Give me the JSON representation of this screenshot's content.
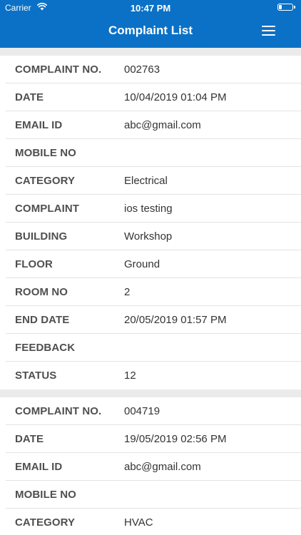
{
  "status_bar": {
    "carrier": "Carrier",
    "time": "10:47 PM",
    "battery_level": 0.2,
    "wifi_icon": "wifi-icon",
    "battery_icon": "battery-icon"
  },
  "header": {
    "title": "Complaint List",
    "menu_icon": "hamburger-menu-icon",
    "background_color": "#0b71c6"
  },
  "complaints": [
    {
      "rows": [
        {
          "label": "COMPLAINT NO.",
          "value": "002763"
        },
        {
          "label": "DATE",
          "value": "10/04/2019 01:04 PM"
        },
        {
          "label": "EMAIL ID",
          "value": "abc@gmail.com"
        },
        {
          "label": "MOBILE NO",
          "value": ""
        },
        {
          "label": "CATEGORY",
          "value": "Electrical"
        },
        {
          "label": "COMPLAINT",
          "value": "ios testing"
        },
        {
          "label": "BUILDING",
          "value": "Workshop"
        },
        {
          "label": "FLOOR",
          "value": "Ground"
        },
        {
          "label": "ROOM NO",
          "value": "2"
        },
        {
          "label": "END DATE",
          "value": "20/05/2019 01:57 PM"
        },
        {
          "label": "FEEDBACK",
          "value": ""
        },
        {
          "label": "STATUS",
          "value": "12"
        }
      ]
    },
    {
      "rows": [
        {
          "label": "COMPLAINT NO.",
          "value": "004719"
        },
        {
          "label": "DATE",
          "value": "19/05/2019 02:56 PM"
        },
        {
          "label": "EMAIL ID",
          "value": "abc@gmail.com"
        },
        {
          "label": "MOBILE NO",
          "value": ""
        },
        {
          "label": "CATEGORY",
          "value": "HVAC"
        }
      ]
    }
  ]
}
